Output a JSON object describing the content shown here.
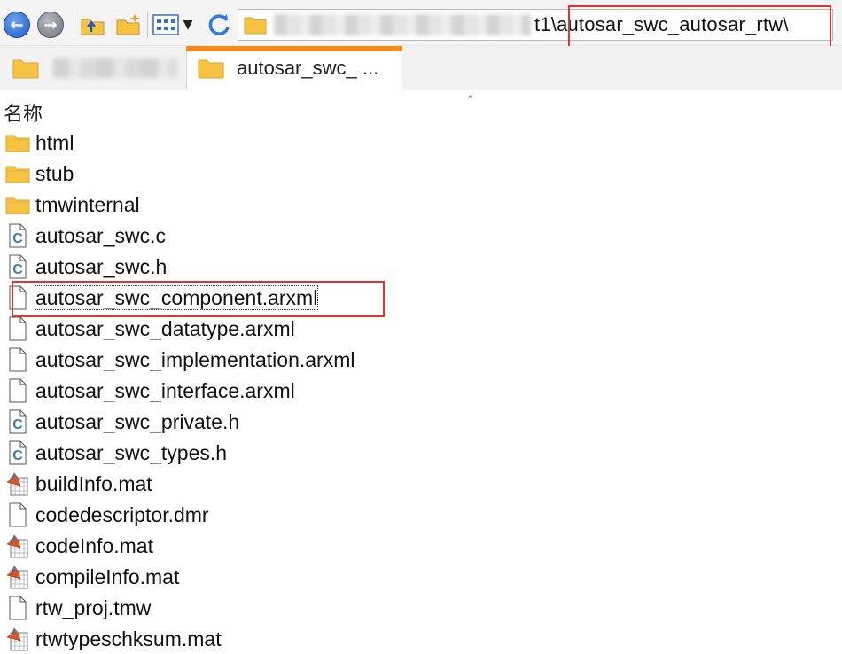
{
  "toolbar": {
    "back_icon": "arrow-left-icon",
    "forward_icon": "arrow-right-icon",
    "up_icon": "up-folder-icon",
    "new_folder_icon": "new-folder-icon",
    "view_icon": "view-grid-icon",
    "refresh_icon": "refresh-icon"
  },
  "address": {
    "path_visible_end": "t1\\",
    "path_highlighted": "autosar_swc_autosar_rtw\\"
  },
  "tabs": [
    {
      "label": "",
      "active": false
    },
    {
      "label": "autosar_swc_ ...",
      "active": true
    }
  ],
  "list": {
    "column_name": "名称",
    "files": [
      {
        "name": "html",
        "icon": "folder-icon"
      },
      {
        "name": "stub",
        "icon": "folder-icon"
      },
      {
        "name": "tmwinternal",
        "icon": "folder-icon"
      },
      {
        "name": "autosar_swc.c",
        "icon": "c-file-icon"
      },
      {
        "name": "autosar_swc.h",
        "icon": "c-file-icon"
      },
      {
        "name": "autosar_swc_component.arxml",
        "icon": "file-icon",
        "highlighted": true
      },
      {
        "name": "autosar_swc_datatype.arxml",
        "icon": "file-icon"
      },
      {
        "name": "autosar_swc_implementation.arxml",
        "icon": "file-icon"
      },
      {
        "name": "autosar_swc_interface.arxml",
        "icon": "file-icon"
      },
      {
        "name": "autosar_swc_private.h",
        "icon": "c-file-icon"
      },
      {
        "name": "autosar_swc_types.h",
        "icon": "c-file-icon"
      },
      {
        "name": "buildInfo.mat",
        "icon": "mat-file-icon"
      },
      {
        "name": "codedescriptor.dmr",
        "icon": "file-icon"
      },
      {
        "name": "codeInfo.mat",
        "icon": "mat-file-icon"
      },
      {
        "name": "compileInfo.mat",
        "icon": "mat-file-icon"
      },
      {
        "name": "rtw_proj.tmw",
        "icon": "file-icon"
      },
      {
        "name": "rtwtypeschksum.mat",
        "icon": "mat-file-icon"
      }
    ]
  },
  "colors": {
    "highlight": "#e0352b",
    "tab_accent": "#f7891e",
    "folder": "#f6c343"
  }
}
